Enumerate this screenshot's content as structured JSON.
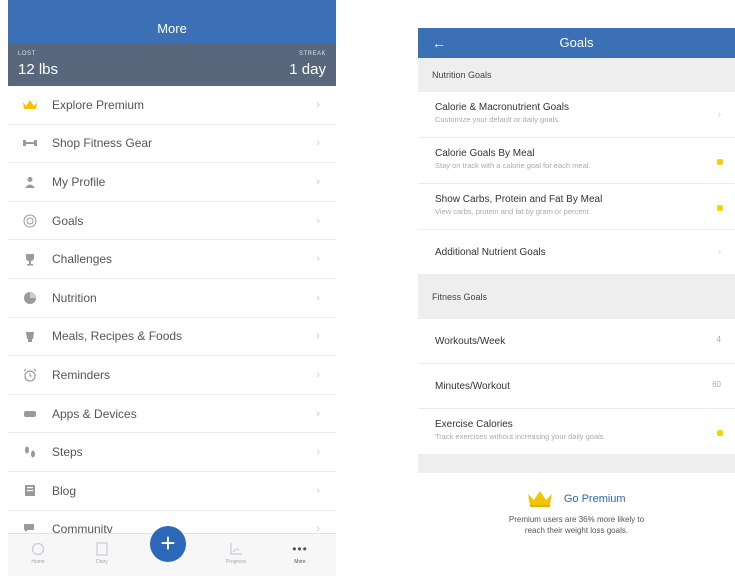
{
  "more_screen": {
    "title": "More",
    "stats": {
      "lost_label": "LOST",
      "lost_value": "12 lbs",
      "streak_label": "STREAK",
      "streak_value": "1 day"
    },
    "menu_items": [
      {
        "label": "Explore Premium",
        "icon": "crown-icon"
      },
      {
        "label": "Shop Fitness Gear",
        "icon": "dumbbell-icon"
      },
      {
        "label": "My Profile",
        "icon": "person-icon"
      },
      {
        "label": "Goals",
        "icon": "target-icon"
      },
      {
        "label": "Challenges",
        "icon": "trophy-icon"
      },
      {
        "label": "Nutrition",
        "icon": "pie-chart-icon"
      },
      {
        "label": "Meals, Recipes & Foods",
        "icon": "food-icon"
      },
      {
        "label": "Reminders",
        "icon": "alarm-clock-icon"
      },
      {
        "label": "Apps & Devices",
        "icon": "devices-icon"
      },
      {
        "label": "Steps",
        "icon": "footsteps-icon"
      },
      {
        "label": "Blog",
        "icon": "blog-icon"
      },
      {
        "label": "Community",
        "icon": "community-icon"
      }
    ],
    "tabbar": {
      "home": "Home",
      "diary": "Diary",
      "add": "+",
      "progress": "Progress",
      "more_icon": "•••",
      "more": "More"
    }
  },
  "goals_screen": {
    "title": "Goals",
    "back": "←",
    "nutrition_header": "Nutrition Goals",
    "nutrition_rows": [
      {
        "title": "Calorie & Macronutrient Goals",
        "subtitle": "Customize your default or daily goals."
      },
      {
        "title": "Calorie Goals By Meal",
        "subtitle": "Stay on track with a calorie goal for each meal."
      },
      {
        "title": "Show Carbs, Protein and Fat By Meal",
        "subtitle": "View carbs, protein and fat by gram or percent."
      },
      {
        "title": "Additional Nutrient Goals"
      }
    ],
    "fitness_header": "Fitness Goals",
    "fitness_rows": [
      {
        "title": "Workouts/Week",
        "value": "4"
      },
      {
        "title": "Minutes/Workout",
        "value": "60"
      },
      {
        "title": "Exercise Calories",
        "subtitle": "Track exercises without increasing your daily goals."
      }
    ],
    "premium": {
      "label": "Go Premium",
      "note_line1": "Premium users are 36% more likely to",
      "note_line2": "reach their weight loss goals."
    }
  },
  "colors": {
    "header_blue": "#3b6fb6",
    "stats_bar": "#58677c",
    "toggle_yellow": "#f2d200",
    "accent": "#2d67b7"
  }
}
